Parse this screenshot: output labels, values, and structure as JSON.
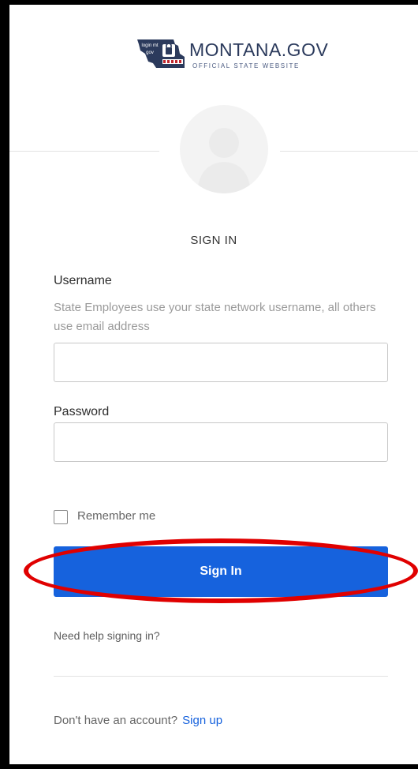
{
  "logo": {
    "badge_text": "login mt gov",
    "title": "MONTANA.GOV",
    "subtitle": "OFFICIAL STATE WEBSITE"
  },
  "form": {
    "heading": "SIGN IN",
    "username": {
      "label": "Username",
      "hint": "State Employees use your state network username, all others use email address",
      "value": "",
      "placeholder": ""
    },
    "password": {
      "label": "Password",
      "value": "",
      "placeholder": ""
    },
    "remember_me": {
      "label": "Remember me",
      "checked": false
    },
    "submit_label": "Sign In",
    "help_link": "Need help signing in?"
  },
  "footer": {
    "prompt": "Don't have an account?",
    "signup_link": "Sign up"
  },
  "colors": {
    "accent": "#1662dd",
    "annotation": "#e00000",
    "frame": "#000000"
  }
}
